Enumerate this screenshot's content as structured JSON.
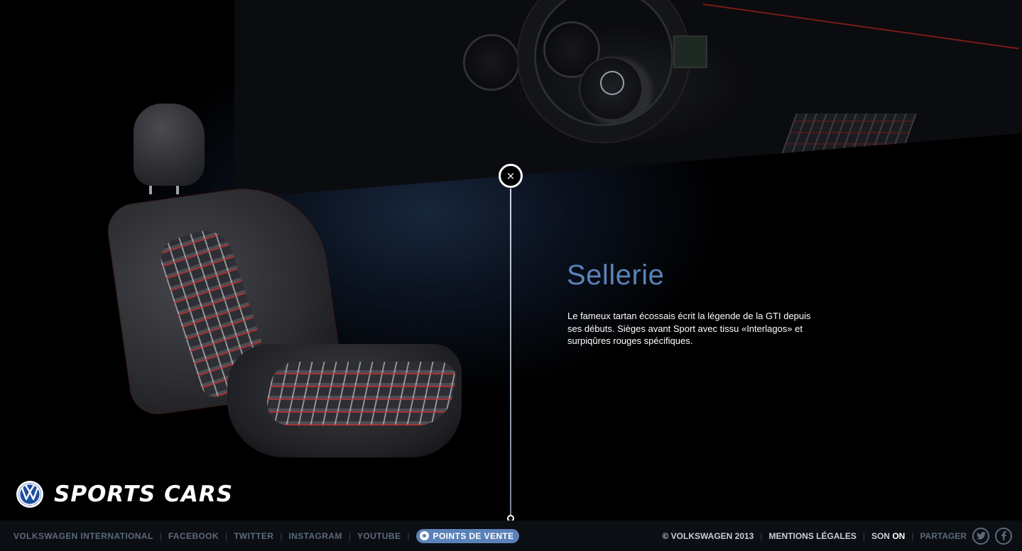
{
  "hero": {
    "close_label": "×",
    "heading": "Sellerie",
    "description": "Le fameux tartan écossais écrit la légende de la GTI depuis ses débuts. Sièges avant Sport avec tissu «Interlagos» et surpiqûres rouges spécifiques."
  },
  "logo": {
    "brand": "SPORTS CARS"
  },
  "footer": {
    "left_links": [
      "VOLKSWAGEN INTERNATIONAL",
      "FACEBOOK",
      "TWITTER",
      "INSTAGRAM",
      "YOUTUBE"
    ],
    "points_de_vente": "POINTS DE VENTE",
    "copyright": "© VOLKSWAGEN 2013",
    "mentions": "MENTIONS LÉGALES",
    "son_label": "SON",
    "son_state": "ON",
    "share_label": "PARTAGER"
  },
  "colors": {
    "accent": "#5b82b8",
    "footer_bg": "#0b0e13",
    "link_muted": "#5d6a7b"
  },
  "icons": [
    "close-icon",
    "vw-logo-icon",
    "map-pin-icon",
    "twitter-icon",
    "facebook-icon"
  ]
}
